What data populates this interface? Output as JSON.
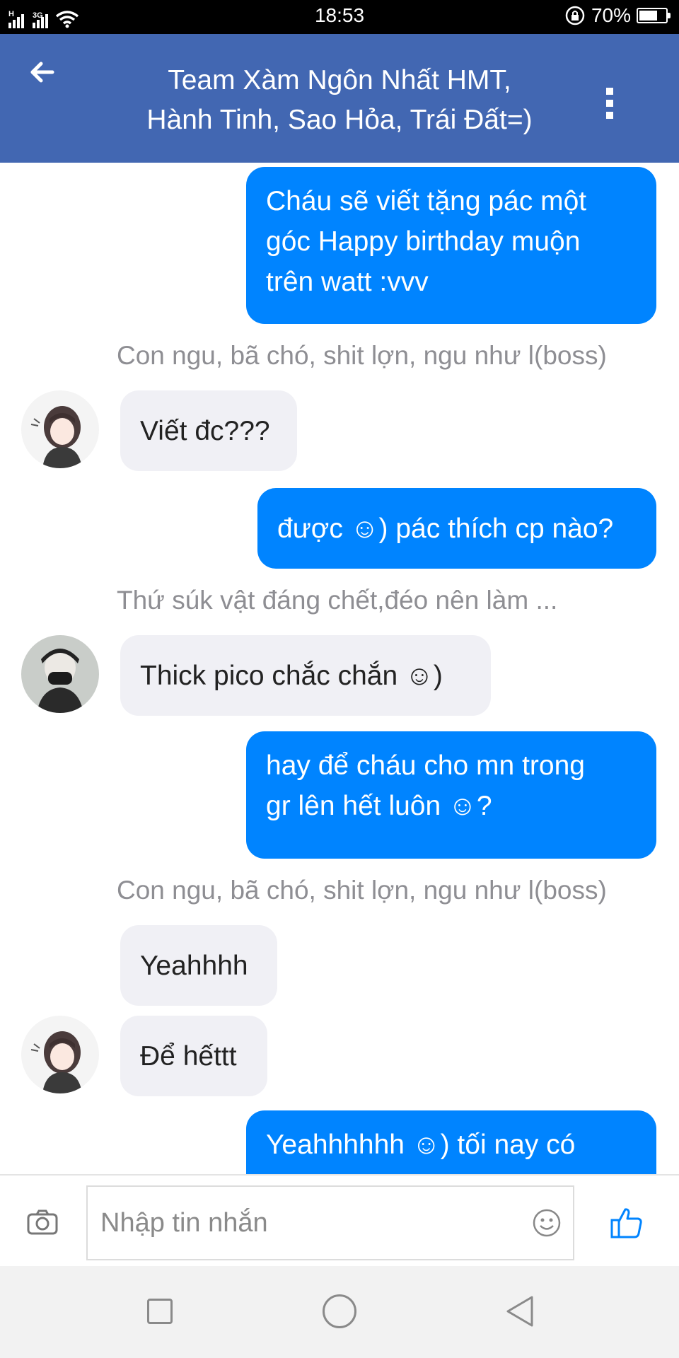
{
  "status_bar": {
    "network_1": "H",
    "network_2": "3G",
    "time": "18:53",
    "battery": "70%",
    "battery_level": 0.7
  },
  "header": {
    "title": "Team Xàm Ngôn Nhất HMT,\nHành Tinh, Sao Hỏa, Trái Đất=)"
  },
  "messages": [
    {
      "type": "outgoing",
      "text": "Cháu sẽ viết tặng pác một\ngóc Happy birthday muộn\ntrên watt :vvv"
    },
    {
      "type": "sender",
      "text": "Con ngu, bã chó, shit lợn, ngu như l(boss)"
    },
    {
      "type": "incoming",
      "text": "Viết đc???"
    },
    {
      "type": "outgoing",
      "text": "được ☺) pác thích cp nào?"
    },
    {
      "type": "sender",
      "text": "Thứ súk vật đáng chết,đéo nên làm ..."
    },
    {
      "type": "incoming",
      "text": "Thick pico chắc chắn ☺)"
    },
    {
      "type": "outgoing",
      "text": "hay để cháu cho mn trong\ngr lên hết luôn ☺?"
    },
    {
      "type": "sender",
      "text": "Con ngu, bã chó, shit lợn, ngu như l(boss)"
    },
    {
      "type": "incoming",
      "text": "Yeahhhh"
    },
    {
      "type": "incoming",
      "text": "Để hếttt"
    },
    {
      "type": "outgoing",
      "text": "Yeahhhhhh ☺) tối nay có"
    }
  ],
  "composer": {
    "placeholder": "Nhập tin nhắn"
  },
  "icons": {
    "back": "arrow-left-icon",
    "more": "more-vertical-icon",
    "camera": "camera-icon",
    "emoji": "smiley-icon",
    "like": "thumbs-up-icon"
  },
  "colors": {
    "header": "#4267b2",
    "outgoing_bubble": "#0084ff",
    "incoming_bubble": "#f0f0f5",
    "like": "#0084ff"
  }
}
